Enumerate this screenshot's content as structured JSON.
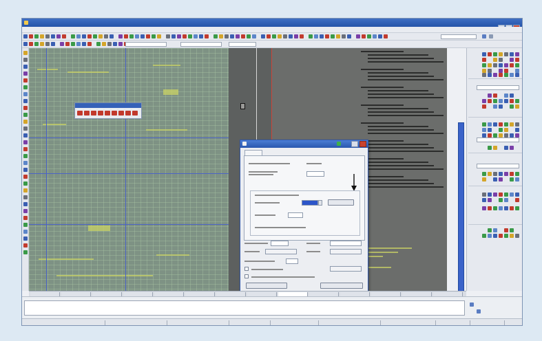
{
  "app": {
    "title": ""
  },
  "menu": {
    "items": []
  },
  "canvas": {
    "object_label": ""
  },
  "float_toolbar": {
    "title": ""
  },
  "dialog": {
    "title": "",
    "tab_label": "",
    "apply_label": "",
    "buttons": [
      "",
      "",
      "",
      "",
      "",
      ""
    ]
  },
  "layout_tabs": [],
  "command_line": {
    "value": ""
  },
  "statusbar": {
    "text": ""
  },
  "colors": {
    "title_bar": "#2f5db3",
    "grid_panel": "#7e9284",
    "drawing_marks": "#c9d264",
    "selection_lines": "#4b63c6",
    "close_button": "#c8422e"
  }
}
